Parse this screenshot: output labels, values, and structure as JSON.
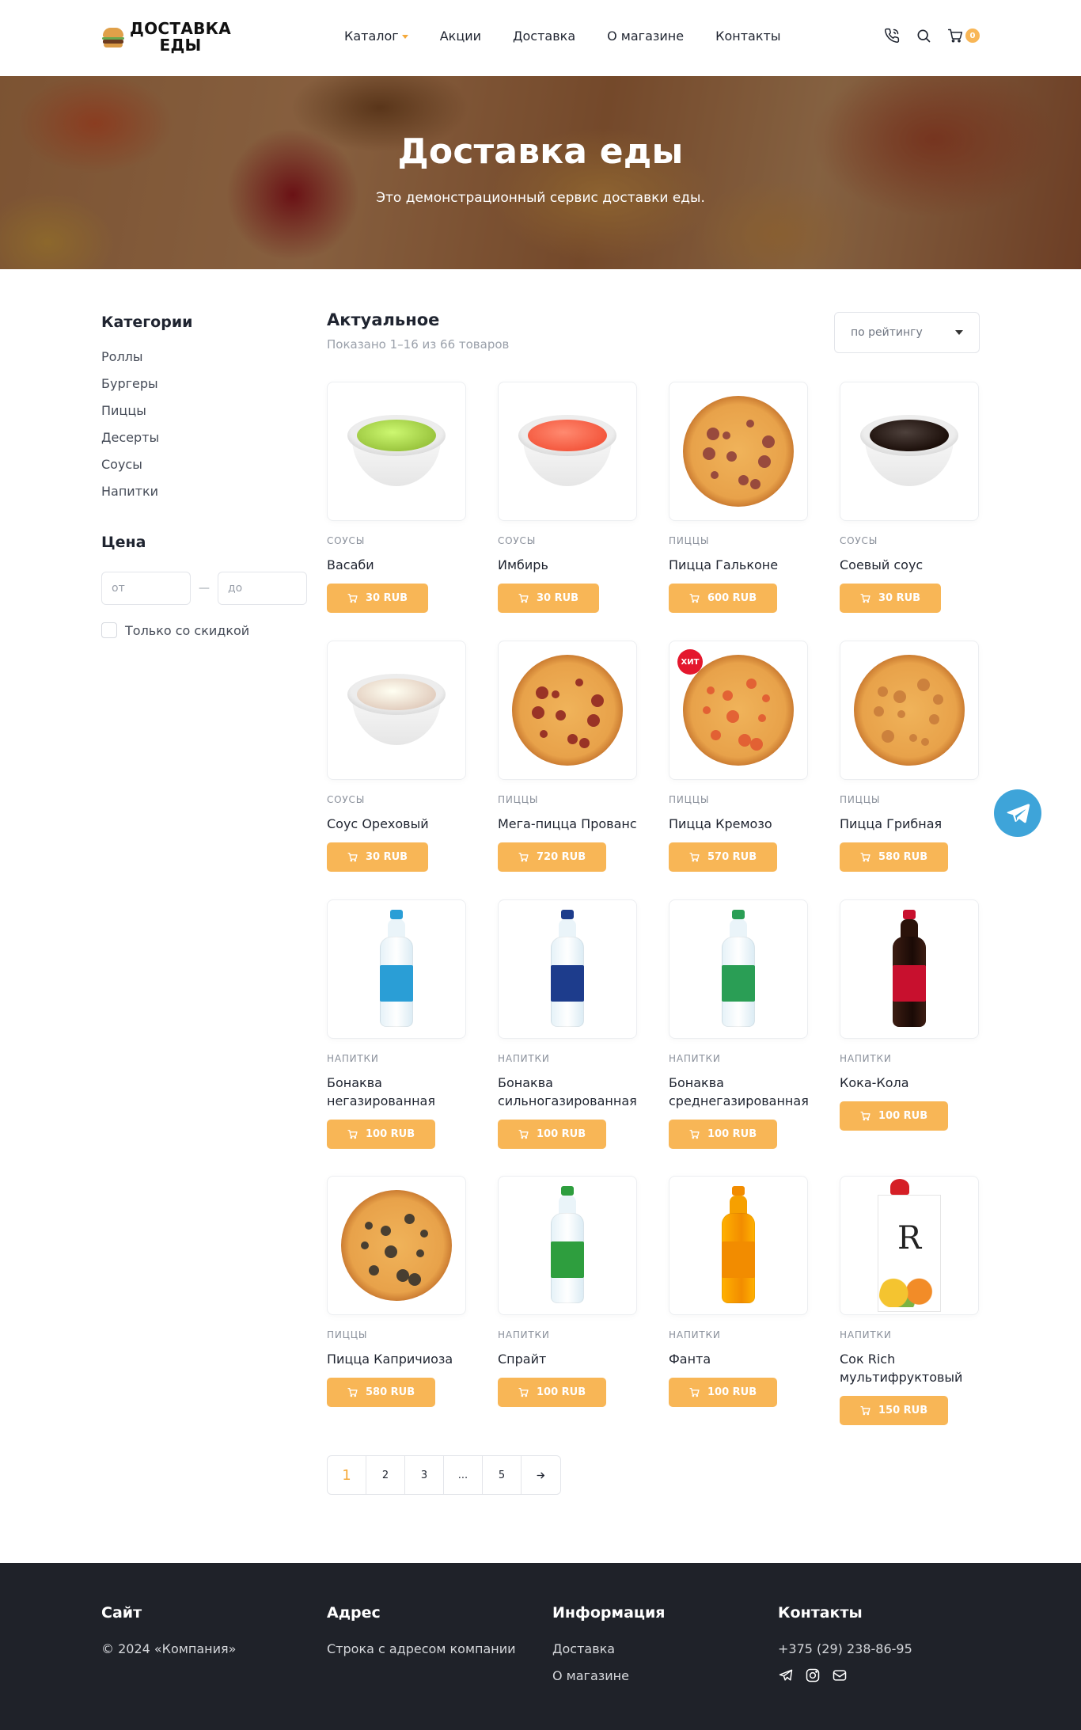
{
  "brand": {
    "name_line1": "ДОСТАВКА",
    "name_line2": "ЕДЫ"
  },
  "nav": {
    "items": [
      {
        "label": "Каталог"
      },
      {
        "label": "Акции"
      },
      {
        "label": "Доставка"
      },
      {
        "label": "О магазине"
      },
      {
        "label": "Контакты"
      }
    ]
  },
  "header": {
    "cart_count": "0"
  },
  "hero": {
    "title": "Доставка еды",
    "subtitle": "Это демонстрационный сервис доставки еды."
  },
  "sidebar": {
    "categories_title": "Категории",
    "categories": [
      "Роллы",
      "Бургеры",
      "Пиццы",
      "Десерты",
      "Соусы",
      "Напитки"
    ],
    "price_title": "Цена",
    "price_from_placeholder": "от",
    "price_to_placeholder": "до",
    "price_dash": "—",
    "discount_label": "Только со скидкой"
  },
  "catalog": {
    "title": "Актуальное",
    "count_text": "Показано 1–16 из 66 товаров",
    "sort_value": "по рейтингу",
    "products": [
      {
        "category": "Соусы",
        "name": "Васаби",
        "price": "30 RUB",
        "art": "bowl",
        "color": "#9bc63f",
        "badge": ""
      },
      {
        "category": "Соусы",
        "name": "Имбирь",
        "price": "30 RUB",
        "art": "bowl",
        "color": "#f4583e",
        "badge": ""
      },
      {
        "category": "Пиццы",
        "name": "Пицца Гальконе",
        "price": "600 RUB",
        "art": "pizza",
        "color": "#8a3a3a",
        "badge": ""
      },
      {
        "category": "Соусы",
        "name": "Соевый соус",
        "price": "30 RUB",
        "art": "bowl",
        "color": "#1c0f0a",
        "badge": ""
      },
      {
        "category": "Соусы",
        "name": "Соус Ореховый",
        "price": "30 RUB",
        "art": "bowl",
        "color": "#e3cfc0",
        "badge": ""
      },
      {
        "category": "Пиццы",
        "name": "Мега-пицца Прованс",
        "price": "720 RUB",
        "art": "pizza",
        "color": "#8b1f1f",
        "badge": ""
      },
      {
        "category": "Пиццы",
        "name": "Пицца Кремозо",
        "price": "570 RUB",
        "art": "pizza",
        "color": "#e0552f",
        "badge": "ХИТ"
      },
      {
        "category": "Пиццы",
        "name": "Пицца Грибная",
        "price": "580 RUB",
        "art": "pizza",
        "color": "#c77a3a",
        "badge": ""
      },
      {
        "category": "Напитки",
        "name": "Бонаква негазированная",
        "price": "100 RUB",
        "art": "bottle",
        "color": "#2a9ed6",
        "badge": ""
      },
      {
        "category": "Напитки",
        "name": "Бонаква сильногазированная",
        "price": "100 RUB",
        "art": "bottle",
        "color": "#1d3c8c",
        "badge": ""
      },
      {
        "category": "Напитки",
        "name": "Бонаква среднегазированная",
        "price": "100 RUB",
        "art": "bottle",
        "color": "#2a9e55",
        "badge": ""
      },
      {
        "category": "Напитки",
        "name": "Кока-Кола",
        "price": "100 RUB",
        "art": "bottle",
        "color": "#c8102e",
        "badge": ""
      },
      {
        "category": "Пиццы",
        "name": "Пицца Капричиоза",
        "price": "580 RUB",
        "art": "pizza",
        "color": "#2b2b2b",
        "badge": ""
      },
      {
        "category": "Напитки",
        "name": "Спрайт",
        "price": "100 RUB",
        "art": "bottle",
        "color": "#2e9e3e",
        "badge": ""
      },
      {
        "category": "Напитки",
        "name": "Фанта",
        "price": "100 RUB",
        "art": "bottle",
        "color": "#f28c00",
        "badge": ""
      },
      {
        "category": "Напитки",
        "name": "Сок Rich мультифруктовый",
        "price": "150 RUB",
        "art": "carton",
        "color": "#d51f26",
        "badge": ""
      }
    ]
  },
  "pagination": {
    "pages": [
      "1",
      "2",
      "3",
      "...",
      "5"
    ],
    "active": "1"
  },
  "footer": {
    "site_title": "Сайт",
    "copyright": "© 2024 «Компания»",
    "address_title": "Адрес",
    "address": "Строка с адресом компании",
    "info_title": "Информация",
    "info_links": [
      "Доставка",
      "О магазине"
    ],
    "contacts_title": "Контакты",
    "phone": "+375 (29) 238-86-95"
  },
  "colors": {
    "accent": "#f8b656",
    "telegram": "#3ea4d9",
    "footer_bg": "#1f2229",
    "hit": "#e4172d"
  },
  "icons": [
    "phone-icon",
    "search-icon",
    "cart-icon",
    "telegram-icon",
    "instagram-icon",
    "mail-icon"
  ]
}
